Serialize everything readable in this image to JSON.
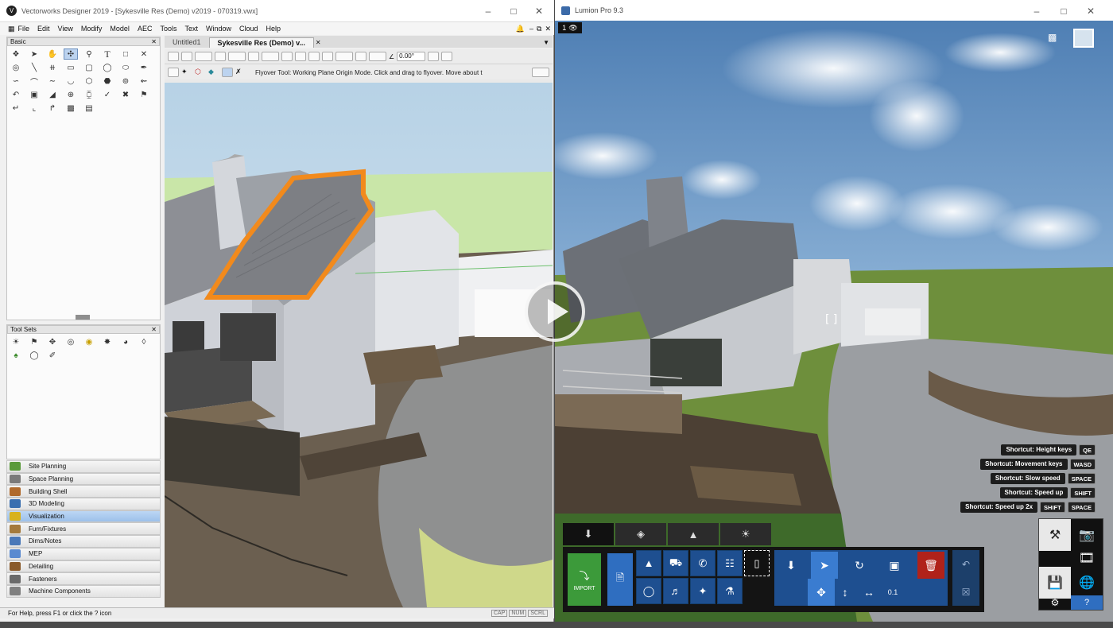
{
  "vectorworks": {
    "title": "Vectorworks Designer 2019 - [Sykesville Res (Demo) v2019 - 070319.vwx]",
    "menu": [
      "File",
      "Edit",
      "View",
      "Modify",
      "Model",
      "AEC",
      "Tools",
      "Text",
      "Window",
      "Cloud",
      "Help"
    ],
    "basic_palette": "Basic",
    "tool_sets_palette": "Tool Sets",
    "doc_tabs": [
      "Untitled1",
      "Sykesville Res (Demo) v..."
    ],
    "angle_field": "0.00°",
    "mode_hint": "Flyover Tool: Working Plane Origin Mode. Click and drag to flyover.  Move about t",
    "tool_sets": [
      {
        "label": "Site Planning",
        "color": "#5a9a3a"
      },
      {
        "label": "Space Planning",
        "color": "#7a7a7a"
      },
      {
        "label": "Building Shell",
        "color": "#b06a2c"
      },
      {
        "label": "3D Modeling",
        "color": "#3a6fb0"
      },
      {
        "label": "Visualization",
        "color": "#d8b21c",
        "active": true
      },
      {
        "label": "Furn/Fixtures",
        "color": "#a47a3c"
      },
      {
        "label": "Dims/Notes",
        "color": "#4a78b8"
      },
      {
        "label": "MEP",
        "color": "#5a8ad0"
      },
      {
        "label": "Detailing",
        "color": "#8a5a2a"
      },
      {
        "label": "Fasteners",
        "color": "#6a6a6a"
      },
      {
        "label": "Machine Components",
        "color": "#808080"
      }
    ],
    "status_help": "For Help, press F1 or click the ? icon",
    "status_keys": [
      "CAP",
      "NUM",
      "SCRL"
    ]
  },
  "lumion": {
    "title": "Lumion Pro 9.3",
    "camera_badge": "1",
    "import_label": "IMPORT",
    "shortcuts": [
      {
        "label": "Shortcut: Height keys",
        "keys": [
          "QE"
        ]
      },
      {
        "label": "Shortcut: Movement keys",
        "keys": [
          "WASD"
        ]
      },
      {
        "label": "Shortcut: Slow speed",
        "keys": [
          "SPACE"
        ]
      },
      {
        "label": "Shortcut: Speed up",
        "keys": [
          "SHIFT"
        ]
      },
      {
        "label": "Shortcut: Speed up 2x",
        "keys": [
          "SHIFT",
          "SPACE"
        ]
      }
    ],
    "coord_readout": "0.1"
  },
  "icons": {
    "play": "play-icon",
    "camera": "camera-icon",
    "help": "?"
  }
}
